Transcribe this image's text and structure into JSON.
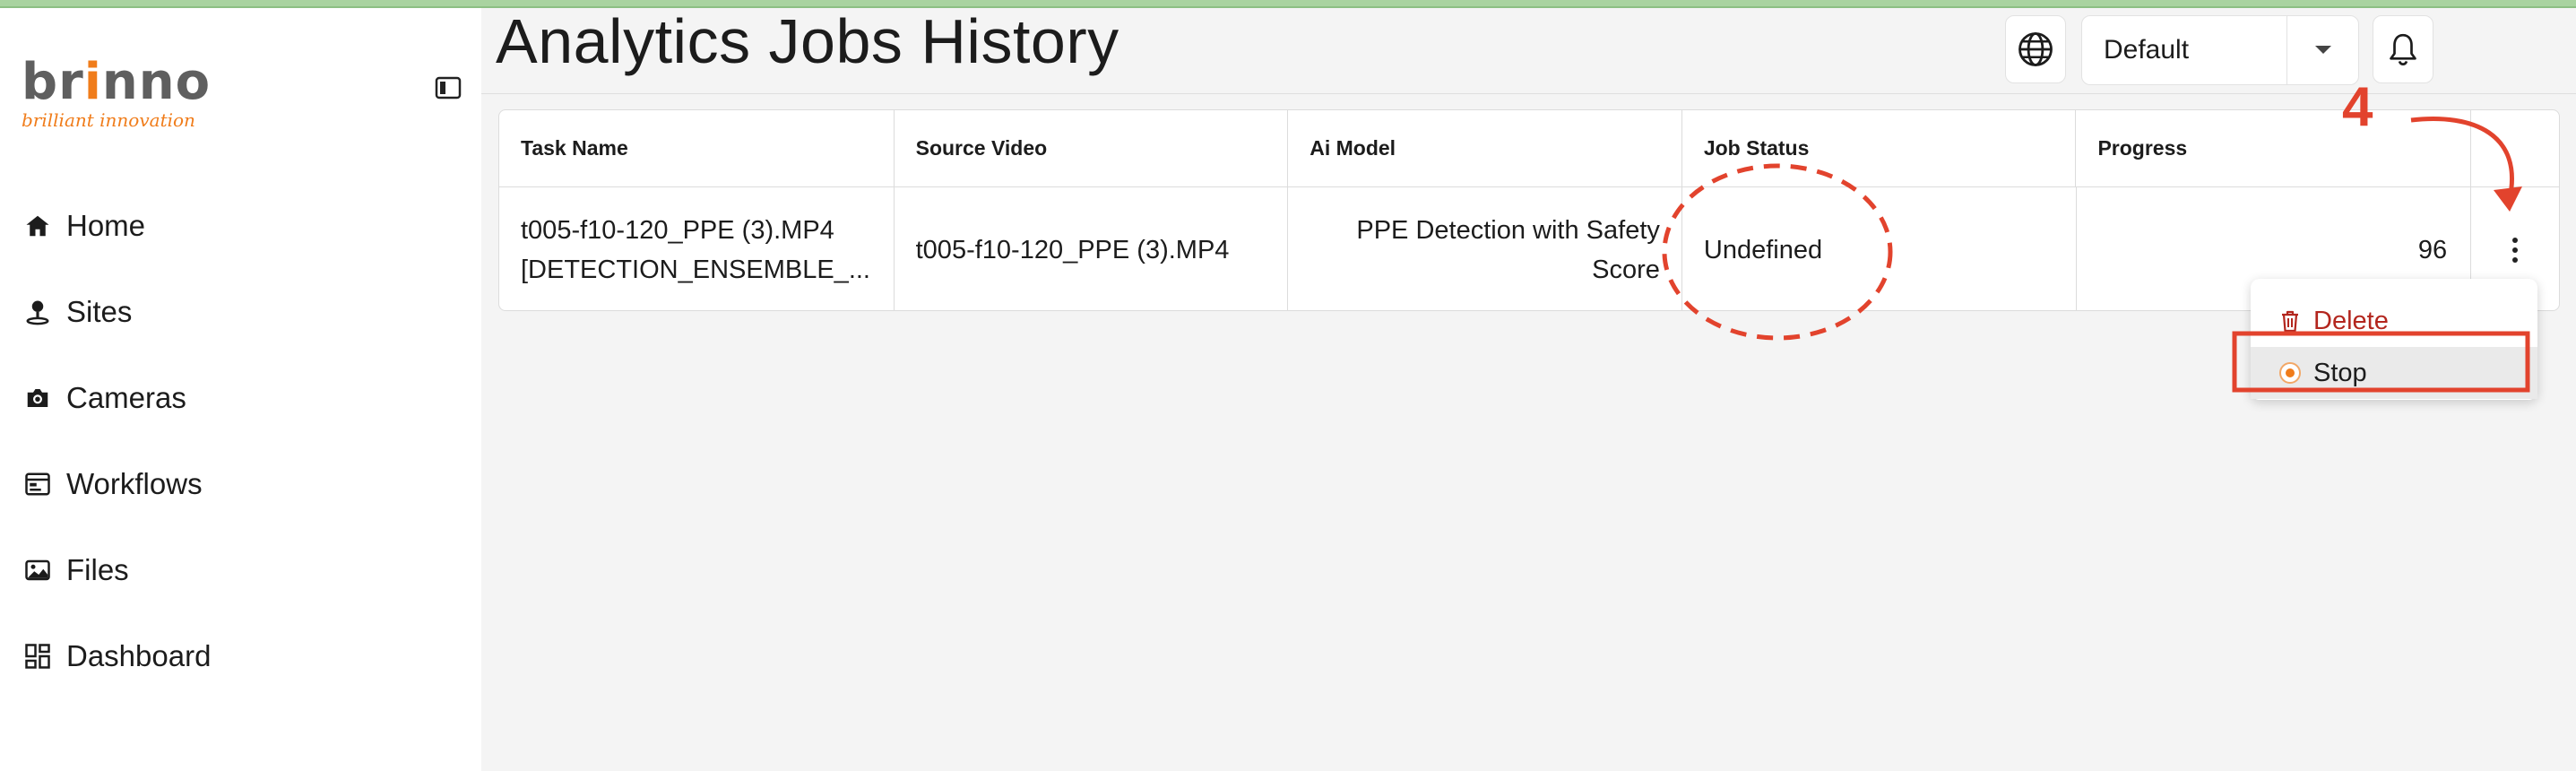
{
  "app": {
    "logo_word_a": "br",
    "logo_word_b": "i",
    "logo_word_c": "nno",
    "logo_tagline": "brilliant innovation"
  },
  "sidebar": {
    "items": [
      {
        "label": "Home",
        "icon": "home-icon"
      },
      {
        "label": "Sites",
        "icon": "sites-pin-icon"
      },
      {
        "label": "Cameras",
        "icon": "camera-icon"
      },
      {
        "label": "Workflows",
        "icon": "workflows-icon"
      },
      {
        "label": "Files",
        "icon": "files-image-icon"
      },
      {
        "label": "Dashboard",
        "icon": "dashboard-grid-icon"
      }
    ]
  },
  "header": {
    "title": "Analytics Jobs History",
    "language_value": "Default"
  },
  "table": {
    "columns": [
      "Task Name",
      "Source Video",
      "Ai Model",
      "Job Status",
      "Progress"
    ],
    "rows": [
      {
        "task_name_line1": "t005-f10-120_PPE (3).MP4",
        "task_name_line2": "[DETECTION_ENSEMBLE_...",
        "source_video": "t005-f10-120_PPE (3).MP4",
        "ai_model_line1": "PPE Detection with Safety",
        "ai_model_line2": "Score",
        "job_status": "Undefined",
        "progress": "96"
      }
    ]
  },
  "menu": {
    "delete_label": "Delete",
    "stop_label": "Stop"
  },
  "annotation": {
    "step_number": "4",
    "color": "#e2432d"
  },
  "colors": {
    "brand_orange": "#f07c1a",
    "delete_red": "#b3261e",
    "top_accent_green": "#a9d3a0"
  }
}
